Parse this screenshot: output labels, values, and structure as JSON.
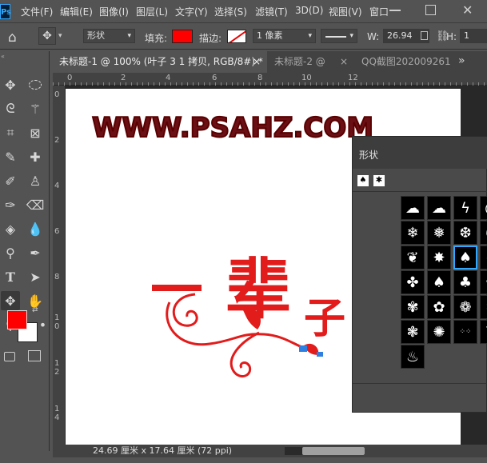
{
  "menubar": {
    "logo": "Ps",
    "items": [
      "文件(F)",
      "编辑(E)",
      "图像(I)",
      "图层(L)",
      "文字(Y)",
      "选择(S)",
      "滤镜(T)",
      "3D(D)",
      "视图(V)",
      "窗口"
    ]
  },
  "options": {
    "mode": "形状",
    "fill_label": "填充:",
    "fill_color": "#ff0000",
    "stroke_label": "描边:",
    "stroke_width": "1 像素",
    "width_label": "W:",
    "width_value": "26.94",
    "height_label": "H:",
    "height_value": "1"
  },
  "tabs": [
    {
      "label": "未标题-1 @ 100% (叶子 3 1 拷贝, RGB/8#) *",
      "close": "×",
      "active": true
    },
    {
      "label": "未标题-2 @",
      "close": "×",
      "active": false
    },
    {
      "label": "QQ截图202009261",
      "close": "",
      "active": false
    }
  ],
  "tabs_more": "»",
  "ruler": {
    "h_ticks": [
      "0",
      "2",
      "4",
      "6",
      "8",
      "10",
      "12"
    ],
    "v_ticks": [
      "0",
      "2",
      "4",
      "6",
      "8",
      "1\n0",
      "1\n2",
      "1\n4"
    ]
  },
  "canvas": {
    "watermark": "WWW.PSAHZ.COM",
    "chars": [
      "一",
      "辈",
      "子"
    ]
  },
  "status": {
    "doc_size": "24.69 厘米 x 17.64 厘米 (72 ppi)"
  },
  "shape_panel": {
    "title": "形状",
    "shapes": [
      "cloud",
      "cloud-outline",
      "lightning",
      "swirl",
      "snowflake-1",
      "snowflake-2",
      "snowflake-3",
      "curl",
      "leaf-1",
      "maple-leaf",
      "leaf-selected",
      "leaf-4",
      "leaf-5",
      "leaf-6",
      "leaf-7",
      "leaf-8",
      "flower-1",
      "flower-2",
      "flower-3",
      "flower-4",
      "flower-5",
      "flower-6",
      "dots",
      "grass",
      "grass-2"
    ]
  },
  "colors": {
    "foreground": "#ff0000",
    "background": "#ffffff",
    "selection": "#31a8ff",
    "watermark": "#6a0f14",
    "artwork": "#e21b1b"
  }
}
